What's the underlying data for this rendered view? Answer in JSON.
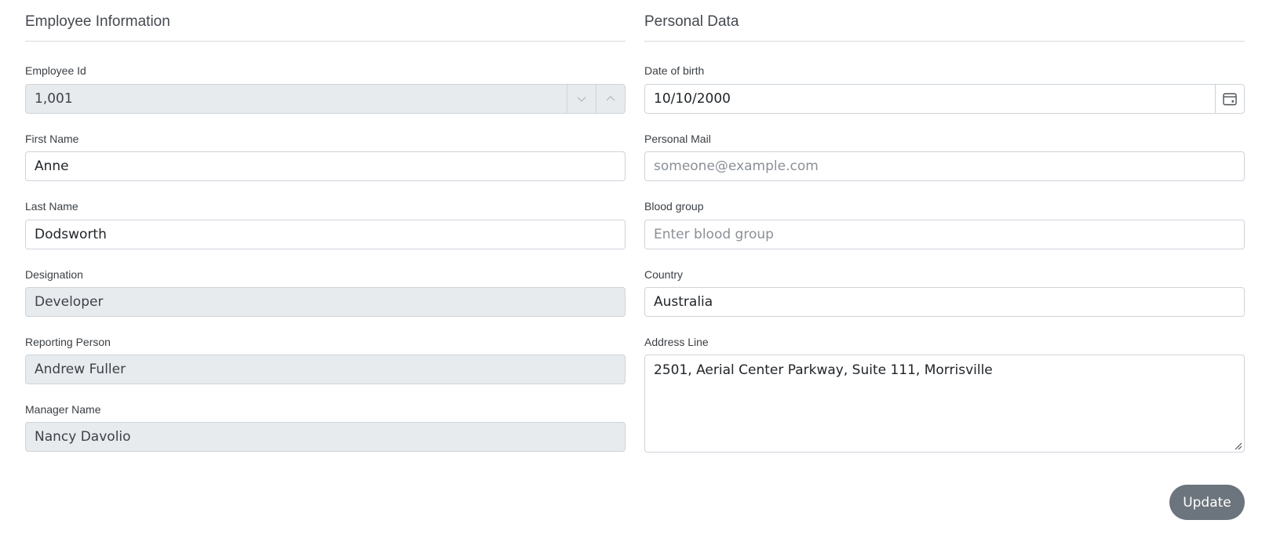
{
  "employee_info": {
    "title": "Employee Information",
    "employee_id": {
      "label": "Employee Id",
      "value": "1,001"
    },
    "first_name": {
      "label": "First Name",
      "value": "Anne"
    },
    "last_name": {
      "label": "Last Name",
      "value": "Dodsworth"
    },
    "designation": {
      "label": "Designation",
      "value": "Developer"
    },
    "reporting_person": {
      "label": "Reporting Person",
      "value": "Andrew Fuller"
    },
    "manager_name": {
      "label": "Manager Name",
      "value": "Nancy Davolio"
    }
  },
  "personal_data": {
    "title": "Personal Data",
    "date_of_birth": {
      "label": "Date of birth",
      "value": "10/10/2000"
    },
    "personal_mail": {
      "label": "Personal Mail",
      "placeholder": "someone@example.com",
      "value": ""
    },
    "blood_group": {
      "label": "Blood group",
      "placeholder": "Enter blood group",
      "value": ""
    },
    "country": {
      "label": "Country",
      "value": "Australia"
    },
    "address_line": {
      "label": "Address Line",
      "value": "2501, Aerial Center Parkway, Suite 111, Morrisville"
    }
  },
  "actions": {
    "update_label": "Update"
  },
  "icons": {
    "spin_down": "chevron-down-icon",
    "spin_up": "chevron-up-icon",
    "calendar": "calendar-icon",
    "resize": "resize-grip-icon"
  },
  "colors": {
    "button_bg": "#6c757d",
    "disabled_bg": "#e8ebee",
    "border": "#ced4da"
  }
}
